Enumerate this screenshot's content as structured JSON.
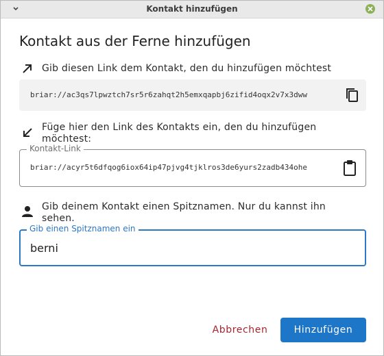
{
  "window": {
    "title": "Kontakt hinzufügen"
  },
  "heading": "Kontakt aus der Ferne hinzufügen",
  "my_link": {
    "instruction": "Gib diesen Link dem Kontakt, den du hinzufügen möchtest",
    "value": "briar://ac3qs7lpwztch7sr5r6zahqt2h5emxqapbj6zifid4oqx2v7x3dww"
  },
  "contact_link": {
    "instruction": "Füge hier den Link des Kontakts ein, den du hinzufügen möchtest:",
    "label": "Kontakt-Link",
    "value": "briar://acyr5t6dfqog6iox64ip47pjvg4tjklros3de6yurs2zadb434ohe"
  },
  "nickname": {
    "instruction": "Gib deinem Kontakt einen Spitznamen. Nur du kannst ihn sehen.",
    "label": "Gib einen Spitznamen ein",
    "value": "berni"
  },
  "actions": {
    "cancel": "Abbrechen",
    "add": "Hinzufügen"
  },
  "colors": {
    "primary": "#1e76c8",
    "cancel": "#a5242e",
    "titlebar_close": "#8bb158"
  }
}
